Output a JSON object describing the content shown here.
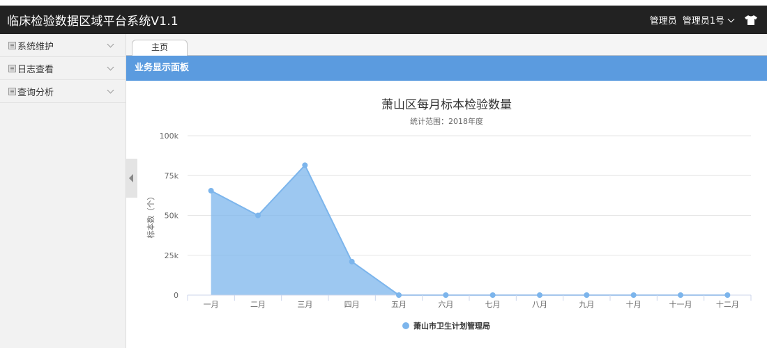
{
  "app": {
    "title": "临床检验数据区域平台系统V1.1",
    "role": "管理员",
    "user": "管理员1号"
  },
  "sidebar": {
    "items": [
      {
        "label": "系统维护"
      },
      {
        "label": "日志查看"
      },
      {
        "label": "查询分析"
      }
    ]
  },
  "tabs": [
    {
      "label": "主页"
    }
  ],
  "panel": {
    "title": "业务显示面板"
  },
  "colors": {
    "topbar": "#222222",
    "panel_header": "#5b9bdf",
    "series": "#7cb5ec"
  },
  "chart_data": {
    "type": "area",
    "title": "萧山区每月标本检验数量",
    "subtitle": "统计范围：2018年度",
    "ylabel": "标本数（个）",
    "xlabel": "",
    "categories": [
      "一月",
      "二月",
      "三月",
      "四月",
      "五月",
      "六月",
      "七月",
      "八月",
      "九月",
      "十月",
      "十一月",
      "十二月"
    ],
    "yticks": [
      "0",
      "25k",
      "50k",
      "75k",
      "100k"
    ],
    "ylim": [
      0,
      100000
    ],
    "grid": true,
    "legend_position": "bottom-center",
    "series": [
      {
        "name": "萧山市卫生计划管理局",
        "values": [
          65500,
          50000,
          81500,
          21000,
          0,
          0,
          0,
          0,
          0,
          0,
          0,
          0
        ]
      }
    ]
  }
}
